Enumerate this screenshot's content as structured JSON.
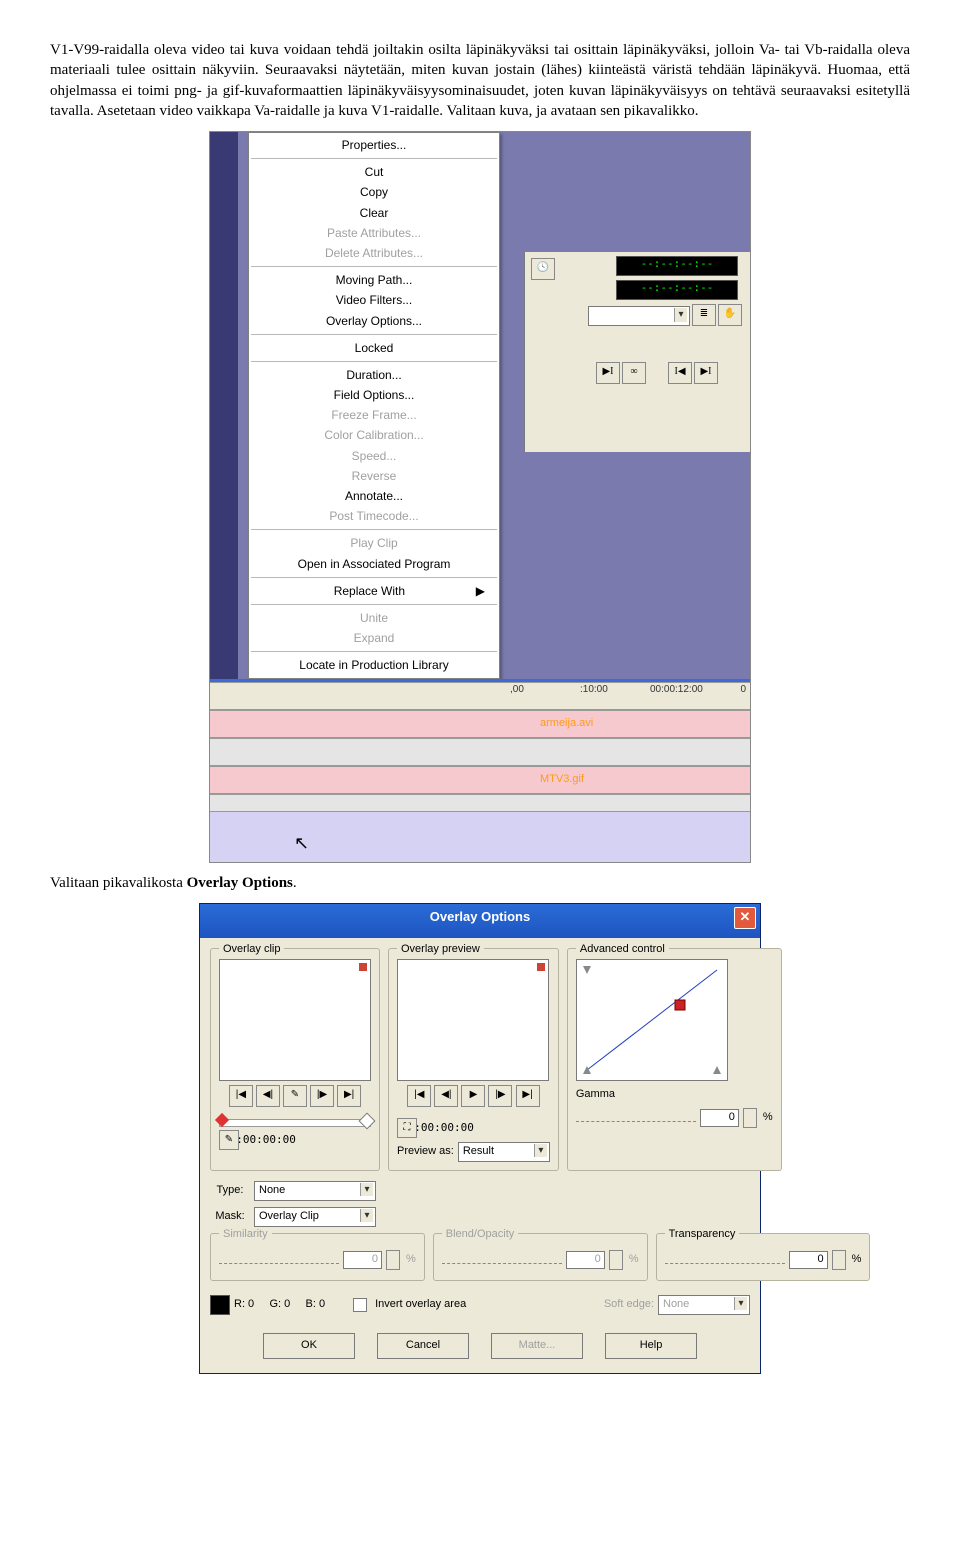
{
  "para1": "V1-V99-raidalla oleva video tai kuva voidaan tehdä joiltakin osilta läpinäkyväksi tai osittain läpinäkyväksi, jolloin Va- tai Vb-raidalla oleva materiaali tulee osittain näkyviin. Seuraavaksi näytetään, miten kuvan jostain (lähes) kiinteästä väristä tehdään läpinäkyvä. Huomaa, että ohjelmassa ei toimi png- ja gif-kuvaformaattien läpinäkyväisyysominaisuudet, joten kuvan läpinäkyväisyys on tehtävä seuraavaksi esitetyllä tavalla. Asetetaan video vaikkapa Va-raidalle ja kuva V1-raidalle. Valitaan kuva, ja avataan sen pikavalikko.",
  "para2_a": "Valitaan pikavalikosta ",
  "para2_b": "Overlay Options",
  "para2_c": ".",
  "ctx": {
    "properties": "Properties...",
    "cut": "Cut",
    "copy": "Copy",
    "clear": "Clear",
    "paste_attr": "Paste Attributes...",
    "delete_attr": "Delete Attributes...",
    "moving_path": "Moving Path...",
    "video_filters": "Video Filters...",
    "overlay_options": "Overlay Options...",
    "locked": "Locked",
    "duration": "Duration...",
    "field_options": "Field Options...",
    "freeze": "Freeze Frame...",
    "color_cal": "Color Calibration...",
    "speed": "Speed...",
    "reverse": "Reverse",
    "annotate": "Annotate...",
    "post_tc": "Post Timecode...",
    "play_clip": "Play Clip",
    "open_assoc": "Open in Associated Program",
    "replace_with": "Replace With",
    "unite": "Unite",
    "expand": "Expand",
    "locate": "Locate in Production Library"
  },
  "readout1": "--:--:--:--",
  "readout2": "--:--:--:--",
  "tl": {
    "tc1": ":10:00",
    "tc2": "00:00:12:00"
  },
  "clip_top": "armeija.avi",
  "clip_bot": "MTV3.gif",
  "dlg": {
    "title": "Overlay Options",
    "grp_clip": "Overlay clip",
    "grp_prev": "Overlay preview",
    "grp_adv": "Advanced control",
    "gamma": "Gamma",
    "gamma_val": "0",
    "blend": "Blend/Opacity",
    "blend_val": "0",
    "sim": "Similarity",
    "sim_val": "0",
    "trans": "Transparency",
    "trans_val": "0",
    "type_lbl": "Type:",
    "type_val": "None",
    "mask_lbl": "Mask:",
    "mask_val": "Overlay Clip",
    "preview_lbl": "Preview as:",
    "preview_val": "Result",
    "soft_lbl": "Soft edge:",
    "soft_val": "None",
    "tc_clip": "00:00:00:00",
    "tc_prev": "00:00:00:00",
    "rgb": "R: 0     G: 0     B: 0",
    "invert": "Invert overlay area",
    "ok": "OK",
    "cancel": "Cancel",
    "matte": "Matte...",
    "help": "Help"
  }
}
